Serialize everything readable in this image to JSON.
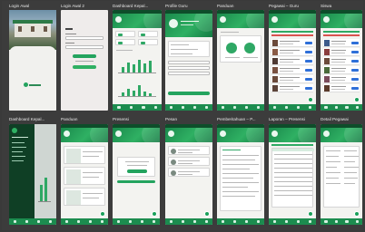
{
  "screens": {
    "login_awal": "Login Awal",
    "login_awal_2": "Login Awal 2",
    "dashboard_kepala_1": "Dashboard Kepal...",
    "profile_guru": "Profile Guru",
    "panduan_1": "Panduan",
    "pegawai_guru": "Pegawai – Guru",
    "siswa": "Siswa",
    "dashboard_kepala_2": "Dashboard Kepal...",
    "panduan_2": "Panduan",
    "presensi": "Presensi",
    "pesan": "Pesan",
    "pemberitahuan": "Pemberitahuan – P...",
    "laporan_presensi": "Laporan – Presensi",
    "detail_pegawai": "Detail Pegawai"
  },
  "colors": {
    "brand_green": "#23a35e",
    "header_green": "#1a8a4c",
    "dark_green": "#0e4d2a",
    "alert_red": "#d9534f",
    "tag_blue": "#2e6fd8",
    "board_bg": "#3c3c3c"
  },
  "icons": [
    "school-building-photo",
    "app-logo-icon",
    "avatar-icon",
    "bar-chart",
    "fab-button-icon",
    "nav-home-icon"
  ]
}
